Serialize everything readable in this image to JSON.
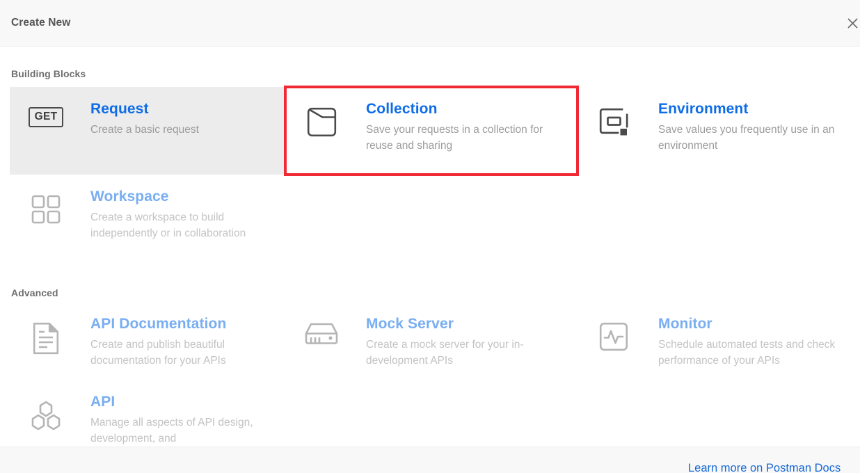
{
  "header": {
    "title": "Create New",
    "close_icon": "close-icon"
  },
  "sections": [
    {
      "label": "Building Blocks",
      "cards": [
        {
          "title": "Request",
          "desc": "Create a basic request",
          "icon": "get-method-badge-icon",
          "state": "hovered"
        },
        {
          "title": "Collection",
          "desc": "Save your requests in a collection for reuse and sharing",
          "icon": "collection-folder-icon",
          "state": "highlighted"
        },
        {
          "title": "Environment",
          "desc": "Save values you frequently use in an environment",
          "icon": "environment-square-icon",
          "state": "normal"
        },
        {
          "title": "Workspace",
          "desc": "Create a workspace to build independently or in collaboration",
          "icon": "workspace-grid-icon",
          "state": "faded"
        }
      ]
    },
    {
      "label": "Advanced",
      "cards": [
        {
          "title": "API Documentation",
          "desc": "Create and publish beautiful documentation for your APIs",
          "icon": "document-page-icon",
          "state": "faded"
        },
        {
          "title": "Mock Server",
          "desc": "Create a mock server for your in-development APIs",
          "icon": "mock-server-rack-icon",
          "state": "faded"
        },
        {
          "title": "Monitor",
          "desc": "Schedule automated tests and check performance of your APIs",
          "icon": "monitor-pulse-icon",
          "state": "faded"
        },
        {
          "title": "API",
          "desc": "Manage all aspects of API design, development, and",
          "icon": "api-hexagons-icon",
          "state": "faded"
        }
      ]
    }
  ],
  "footer": {
    "link_label": "Learn more on Postman Docs"
  },
  "colors": {
    "accent_blue": "#0d6ce8",
    "faded_blue": "#79aef1",
    "highlight_red": "#f02a35",
    "hover_gray": "#ececec",
    "chrome_gray": "#f8f8f8",
    "desc_gray": "#9b9b9b"
  }
}
